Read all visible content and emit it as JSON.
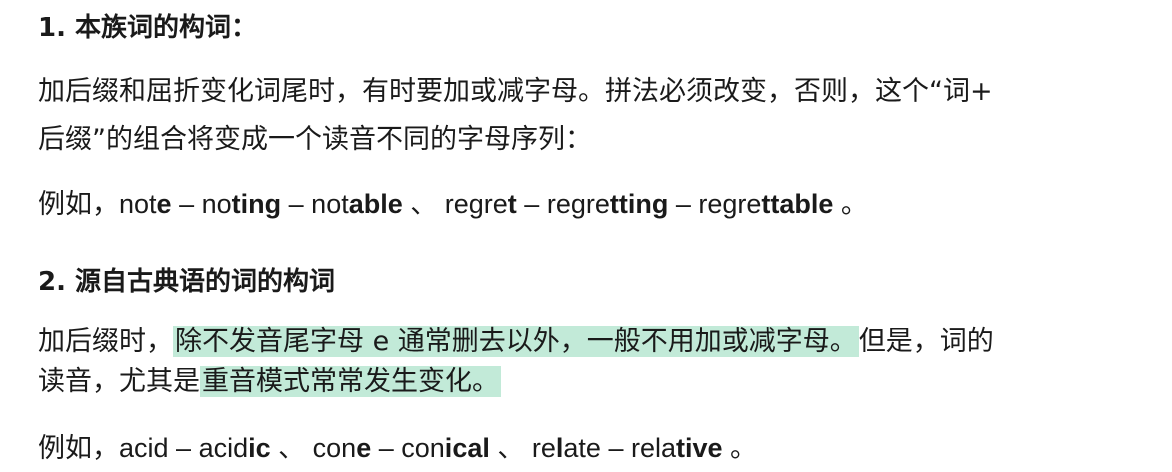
{
  "section1": {
    "heading": "1. 本族词的构词：",
    "para_line1": "加后缀和屈折变化词尾时，有时要加或减字母。拼法必须改变，否则，这个“词+",
    "para_line2": "后缀”的组合将变成一个读音不同的字母序列：",
    "example_prefix": "例如，",
    "ex": [
      {
        "a": "not",
        "b": "e"
      },
      {
        "sep": " – "
      },
      {
        "a": "no",
        "b": "ting"
      },
      {
        "sep": " – "
      },
      {
        "a": "not",
        "b": "able"
      },
      {
        "sep": " 、 "
      },
      {
        "a": "regre",
        "b": "t"
      },
      {
        "sep": " – "
      },
      {
        "a": "regre",
        "b": "tting"
      },
      {
        "sep": " – "
      },
      {
        "a": "regre",
        "b": "ttable"
      },
      {
        "sep": " 。"
      }
    ]
  },
  "section2": {
    "heading": "2. 源自古典语的词的构词",
    "para_line1_pre": "加后缀时，",
    "para_line1_hl": "除不发音尾字母 e 通常删去以外，一般不用加或减字母。",
    "para_line1_post": "但是，词的",
    "para_line2_pre": "读音，尤其是",
    "para_line2_hl": "重音模式常常发生变化。",
    "example_prefix": "例如，",
    "ex1_a": "acid",
    "ex1_sep": " – ",
    "ex1_b1": "acid",
    "ex1_b2": "ic",
    "sep1": " 、 ",
    "ex2_a1": "con",
    "ex2_a2": "e",
    "ex2_sep": " – ",
    "ex2_b1": "con",
    "ex2_b2": "i",
    "ex2_b3": "cal",
    "sep2": " 、 ",
    "ex3_a1": "re",
    "ex3_a2": "l",
    "ex3_a3": "ate",
    "ex3_sep": " – ",
    "ex3_b1": "rela",
    "ex3_b2": "tive",
    "end": " 。"
  },
  "colors": {
    "highlight": "#c2ead8",
    "text": "#1a1a1a"
  }
}
